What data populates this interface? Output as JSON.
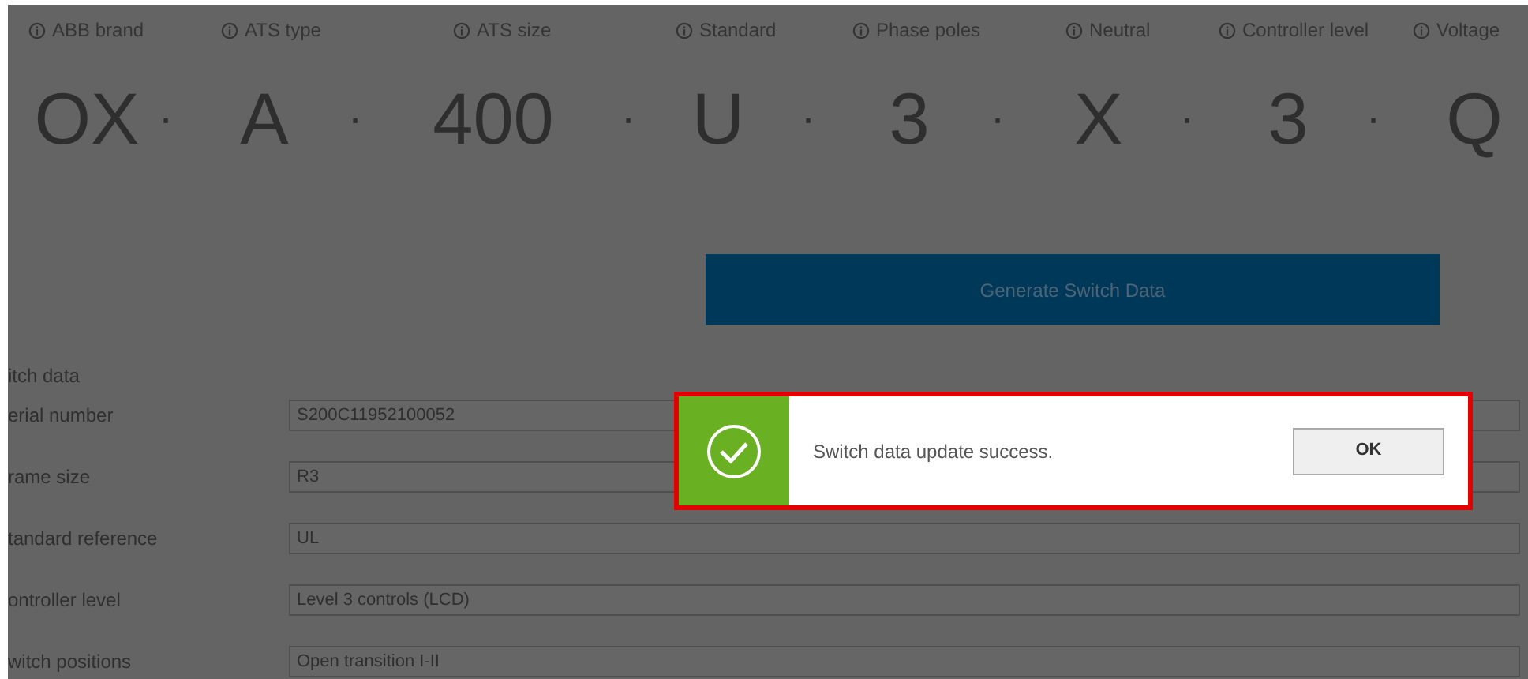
{
  "code_segments": [
    {
      "label": "ABB brand",
      "value": "OX"
    },
    {
      "label": "ATS type",
      "value": "A"
    },
    {
      "label": "ATS size",
      "value": "400"
    },
    {
      "label": "Standard",
      "value": "U"
    },
    {
      "label": "Phase poles",
      "value": "3"
    },
    {
      "label": "Neutral",
      "value": "X"
    },
    {
      "label": "Controller level",
      "value": "3"
    },
    {
      "label": "Voltage",
      "value": "Q"
    }
  ],
  "separator": "·",
  "generate_button": "Generate Switch Data",
  "section_title": "itch data",
  "fields": [
    {
      "label": "erial number",
      "value": "S200C11952100052"
    },
    {
      "label": "rame size",
      "value": "R3"
    },
    {
      "label": "tandard reference",
      "value": "UL"
    },
    {
      "label": "ontroller level",
      "value": "Level 3 controls (LCD)"
    },
    {
      "label": "witch positions",
      "value": "Open transition I-II"
    }
  ],
  "dialog": {
    "message": "Switch data update success.",
    "button": "OK"
  }
}
